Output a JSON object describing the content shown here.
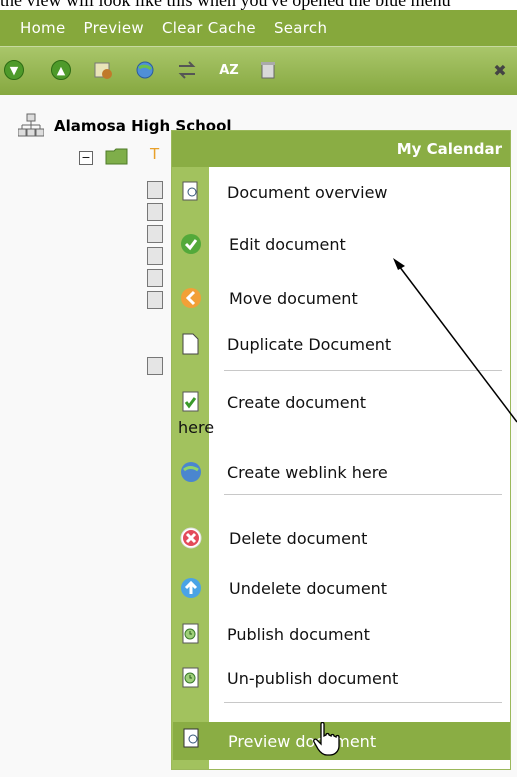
{
  "window": {
    "caption": "the view will look like this when you've opened the blue menu"
  },
  "menubar": {
    "items": [
      "Home",
      "Preview",
      "Clear Cache",
      "Search"
    ]
  },
  "tree": {
    "root_label": "Alamosa High School",
    "folder_label": "T"
  },
  "context_menu": {
    "title": "My Calendar",
    "items": [
      {
        "label": "Document overview",
        "icon": "document-overview-icon"
      },
      {
        "label": "Edit document",
        "icon": "edit-check-icon"
      },
      {
        "label": "Move document",
        "icon": "move-arrow-icon"
      },
      {
        "label": "Duplicate Document",
        "icon": "duplicate-page-icon"
      },
      {
        "label": "Create document here",
        "icon": "create-document-icon"
      },
      {
        "label": "Create weblink here",
        "icon": "globe-icon"
      },
      {
        "label": "Delete document",
        "icon": "delete-x-icon"
      },
      {
        "label": "Undelete document",
        "icon": "undelete-arrow-icon"
      },
      {
        "label": "Publish document",
        "icon": "publish-clock-icon"
      },
      {
        "label": "Un-publish document",
        "icon": "unpublish-clock-icon"
      },
      {
        "label": "Preview document",
        "icon": "preview-document-icon"
      }
    ]
  },
  "colors": {
    "accent_green": "#86a83c",
    "menu_strip": "#a2c25e",
    "selected_item": "#8aad44"
  }
}
